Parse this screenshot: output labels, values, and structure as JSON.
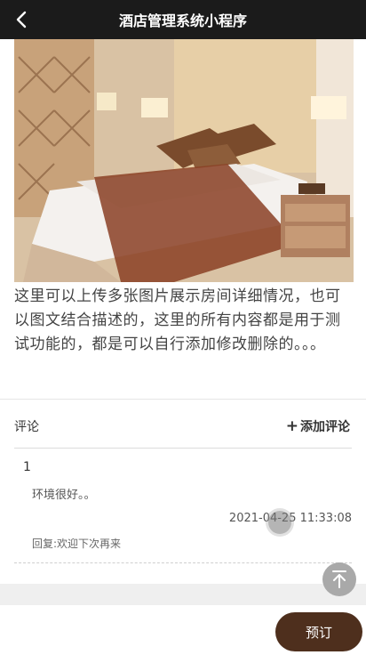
{
  "nav": {
    "title": "酒店管理系统小程序"
  },
  "description": "这里可以上传多张图片展示房间详细情况，也可以图文结合描述的，这里的所有内容都是用于测试功能的，都是可以自行添加修改删除的。。。",
  "comments": {
    "title": "评论",
    "add_label": "添加评论",
    "items": [
      {
        "user": "1",
        "content": "环境很好。。",
        "time": "2021-04-25 11:33:08",
        "reply": "回复:欢迎下次再来"
      }
    ]
  },
  "footer": {
    "book_label": "预订"
  },
  "colors": {
    "navbar": "#1b1b1b",
    "book_button": "#4e2f1d",
    "scroll_top": "#a9a9a9"
  }
}
